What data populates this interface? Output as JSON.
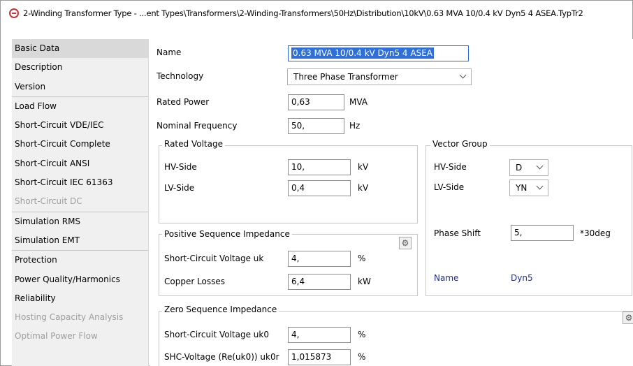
{
  "window": {
    "title": "2-Winding Transformer Type - ...ent Types\\Transformers\\2-Winding-Transformers\\50Hz\\Distribution\\10kV\\0.63 MVA 10/0.4 kV Dyn5 4 ASEA.TypTr2"
  },
  "sidebar": {
    "groups": [
      [
        "Basic Data",
        "Description",
        "Version"
      ],
      [
        "Load Flow",
        "Short-Circuit VDE/IEC",
        "Short-Circuit Complete",
        "Short-Circuit ANSI",
        "Short-Circuit IEC 61363",
        "Short-Circuit DC"
      ],
      [
        "Simulation RMS",
        "Simulation EMT"
      ],
      [
        "Protection",
        "Power Quality/Harmonics",
        "Reliability",
        "Hosting Capacity Analysis",
        "Optimal Power Flow"
      ]
    ]
  },
  "form": {
    "name_label": "Name",
    "name_value": "0.63 MVA 10/0.4 kV Dyn5 4 ASEA",
    "technology_label": "Technology",
    "technology_value": "Three Phase Transformer",
    "rated_power_label": "Rated Power",
    "rated_power_value": "0,63",
    "rated_power_unit": "MVA",
    "nominal_frequency_label": "Nominal Frequency",
    "nominal_frequency_value": "50,",
    "nominal_frequency_unit": "Hz"
  },
  "rated_voltage": {
    "title": "Rated Voltage",
    "hv_label": "HV-Side",
    "hv_value": "10,",
    "hv_unit": "kV",
    "lv_label": "LV-Side",
    "lv_value": "0,4",
    "lv_unit": "kV"
  },
  "vector_group": {
    "title": "Vector Group",
    "hv_label": "HV-Side",
    "hv_value": "D",
    "lv_label": "LV-Side",
    "lv_value": "YN",
    "phase_shift_label": "Phase Shift",
    "phase_shift_value": "5,",
    "phase_shift_unit": "*30deg",
    "name_label": "Name",
    "name_value": "Dyn5"
  },
  "positive_sequence": {
    "title": "Positive Sequence Impedance",
    "uk_label": "Short-Circuit Voltage uk",
    "uk_value": "4,",
    "uk_unit": "%",
    "cu_label": "Copper Losses",
    "cu_value": "6,4",
    "cu_unit": "kW"
  },
  "zero_sequence": {
    "title": "Zero Sequence Impedance",
    "uk0_label": "Short-Circuit Voltage uk0",
    "uk0_value": "4,",
    "uk0_unit": "%",
    "uk0r_label": "SHC-Voltage (Re(uk0)) uk0r",
    "uk0r_value": "1,015873",
    "uk0r_unit": "%"
  },
  "icons": {
    "settings": "gear-icon",
    "app": "app-icon"
  },
  "colors": {
    "selection": "#2e6fd8",
    "vector_name": "#1c2f8f",
    "app_icon": "#d03030"
  }
}
